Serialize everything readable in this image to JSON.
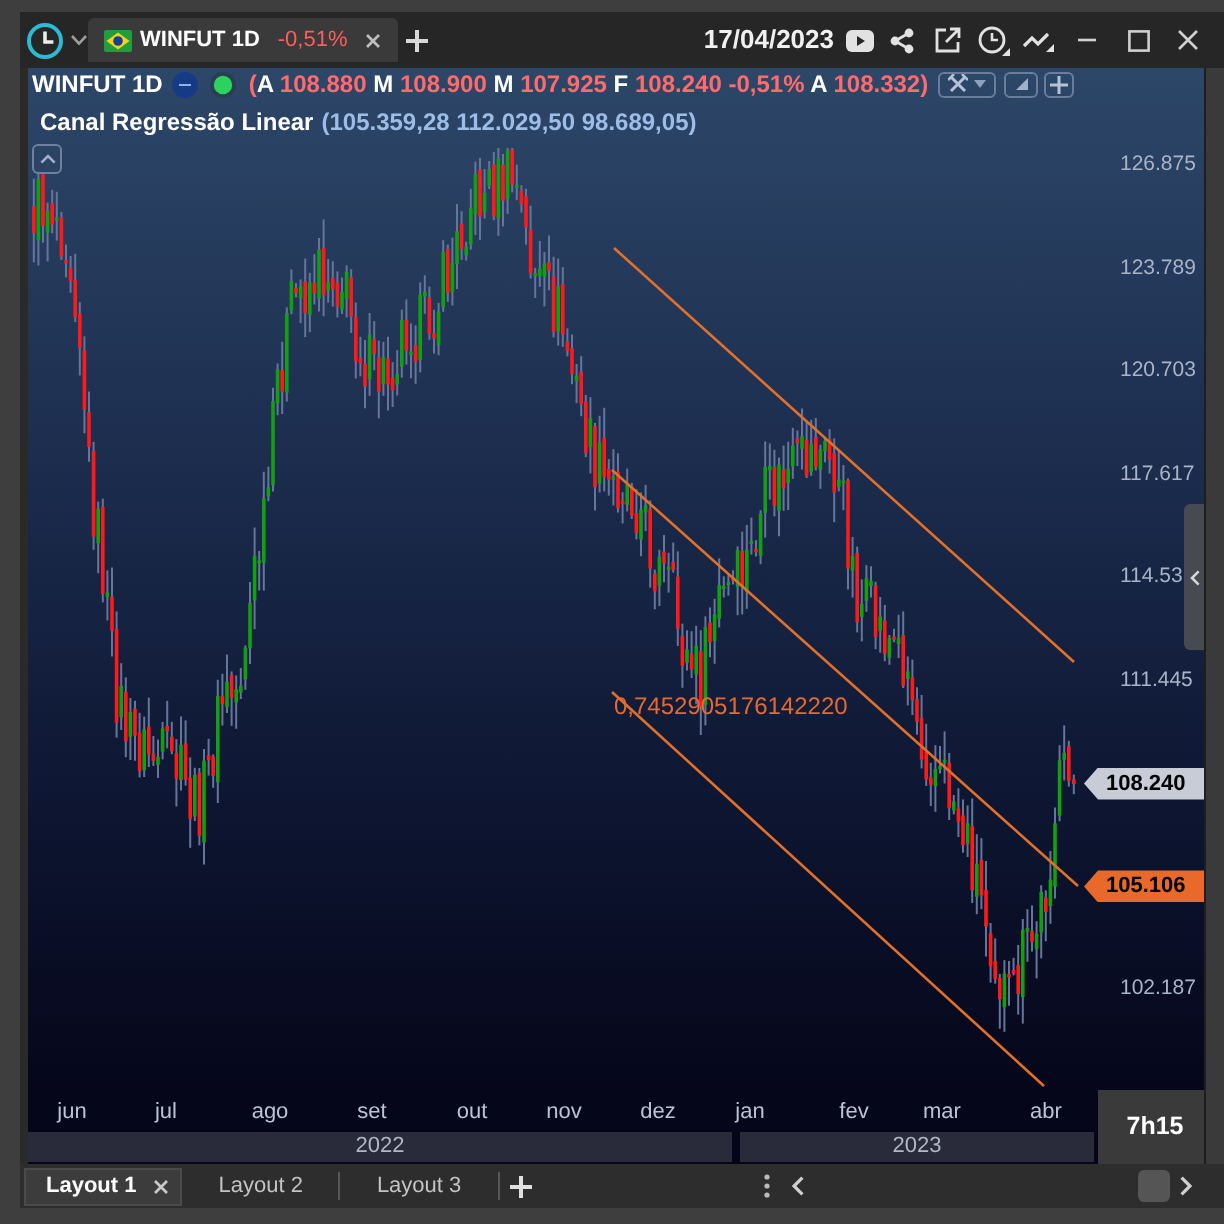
{
  "title_bar": {
    "tabs": [
      {
        "label": "WINFUT 1D",
        "change": "-0,51%",
        "selected": true
      }
    ],
    "date": "17/04/2023"
  },
  "legend": {
    "symbol": "WINFUT 1D",
    "quote": [
      {
        "kind": "open",
        "text": "("
      },
      {
        "kind": "label",
        "text": "A"
      },
      {
        "kind": "value",
        "text": "108.880"
      },
      {
        "kind": "label",
        "text": "M"
      },
      {
        "kind": "value",
        "text": "108.900"
      },
      {
        "kind": "label",
        "text": "M"
      },
      {
        "kind": "value",
        "text": "107.925"
      },
      {
        "kind": "label",
        "text": "F"
      },
      {
        "kind": "value",
        "text": "108.240"
      },
      {
        "kind": "value",
        "text": "-0,51%"
      },
      {
        "kind": "label",
        "text": "A"
      },
      {
        "kind": "value",
        "text": "108.332"
      },
      {
        "kind": "close",
        "text": ")"
      }
    ],
    "indicator": {
      "name": "Canal Regressão Linear",
      "values": "(105.359,28 112.029,50 98.689,05)"
    }
  },
  "chart": {
    "channel_label": "0,7452905176142220"
  },
  "price_axis": [
    {
      "kind": "tick",
      "text": "126.875"
    },
    {
      "kind": "tick",
      "text": "123.789"
    },
    {
      "kind": "tick",
      "text": "120.703"
    },
    {
      "kind": "tick",
      "text": "117.617"
    },
    {
      "kind": "tick",
      "text": "114.53"
    },
    {
      "kind": "tick",
      "text": "111.445"
    },
    {
      "kind": "last-price",
      "text": "108.240"
    },
    {
      "kind": "channel-price",
      "text": "105.106"
    },
    {
      "kind": "tick",
      "text": "102.187"
    }
  ],
  "time_axis": {
    "months": [
      "jun",
      "jul",
      "ago",
      "set",
      "out",
      "nov",
      "dez",
      "jan",
      "fev",
      "mar",
      "abr"
    ],
    "years": [
      "2022",
      "2023"
    ]
  },
  "countdown": "7h15",
  "layout_tabs": [
    {
      "label": "Layout 1",
      "selected": true
    },
    {
      "label": "Layout 2",
      "selected": false
    },
    {
      "label": "Layout 3",
      "selected": false
    }
  ]
}
